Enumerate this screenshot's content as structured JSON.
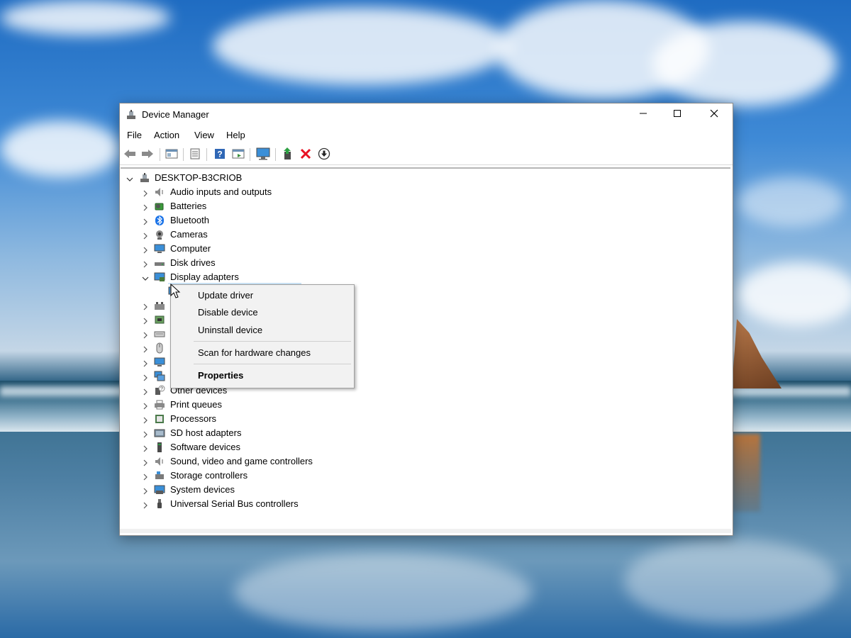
{
  "window": {
    "title": "Device Manager",
    "controls": {
      "minimize": "minimize-icon",
      "maximize": "maximize-icon",
      "close": "close-icon"
    }
  },
  "menubar": [
    "File",
    "Action",
    "View",
    "Help"
  ],
  "toolbar": [
    "back-icon",
    "forward-icon",
    "properties-icon",
    "list-icon",
    "help-icon",
    "view-icon",
    "monitor-icon",
    "update-driver-icon",
    "uninstall-icon",
    "download-icon"
  ],
  "tree": {
    "root": "DESKTOP-B3CRIOB",
    "items": [
      {
        "label": "Audio inputs and outputs",
        "icon": "speaker-icon",
        "expanded": false
      },
      {
        "label": "Batteries",
        "icon": "battery-icon",
        "expanded": false
      },
      {
        "label": "Bluetooth",
        "icon": "bluetooth-icon",
        "expanded": false
      },
      {
        "label": "Cameras",
        "icon": "camera-icon",
        "expanded": false
      },
      {
        "label": "Computer",
        "icon": "computer-icon",
        "expanded": false
      },
      {
        "label": "Disk drives",
        "icon": "disk-icon",
        "expanded": false
      },
      {
        "label": "Display adapters",
        "icon": "display-adapter-icon",
        "expanded": true
      },
      {
        "label": "",
        "icon": "display-adapter-icon",
        "expanded": false
      },
      {
        "label": "",
        "icon": "hid-icon",
        "expanded": false
      },
      {
        "label": "",
        "icon": "ide-icon",
        "expanded": false
      },
      {
        "label": "",
        "icon": "keyboard-icon",
        "expanded": false
      },
      {
        "label": "",
        "icon": "mouse-icon",
        "expanded": false
      },
      {
        "label": "",
        "icon": "monitor-icon",
        "expanded": false
      },
      {
        "label": "",
        "icon": "network-icon",
        "expanded": false
      },
      {
        "label": "Other devices",
        "icon": "unknown-device-icon",
        "expanded": false
      },
      {
        "label": "Print queues",
        "icon": "printer-icon",
        "expanded": false
      },
      {
        "label": "Processors",
        "icon": "cpu-icon",
        "expanded": false
      },
      {
        "label": "SD host adapters",
        "icon": "sd-card-icon",
        "expanded": false
      },
      {
        "label": "Software devices",
        "icon": "software-icon",
        "expanded": false
      },
      {
        "label": "Sound, video and game controllers",
        "icon": "speaker-icon",
        "expanded": false
      },
      {
        "label": "Storage controllers",
        "icon": "storage-icon",
        "expanded": false
      },
      {
        "label": "System devices",
        "icon": "system-icon",
        "expanded": false
      },
      {
        "label": "Universal Serial Bus controllers",
        "icon": "usb-icon",
        "expanded": false
      }
    ]
  },
  "context_menu": {
    "items": [
      "Update driver",
      "Disable device",
      "Uninstall device",
      "Scan for hardware changes",
      "Properties"
    ]
  },
  "colors": {
    "accent": "#0078d7",
    "selection": "#cce4f7",
    "uninstall": "#e81123"
  }
}
